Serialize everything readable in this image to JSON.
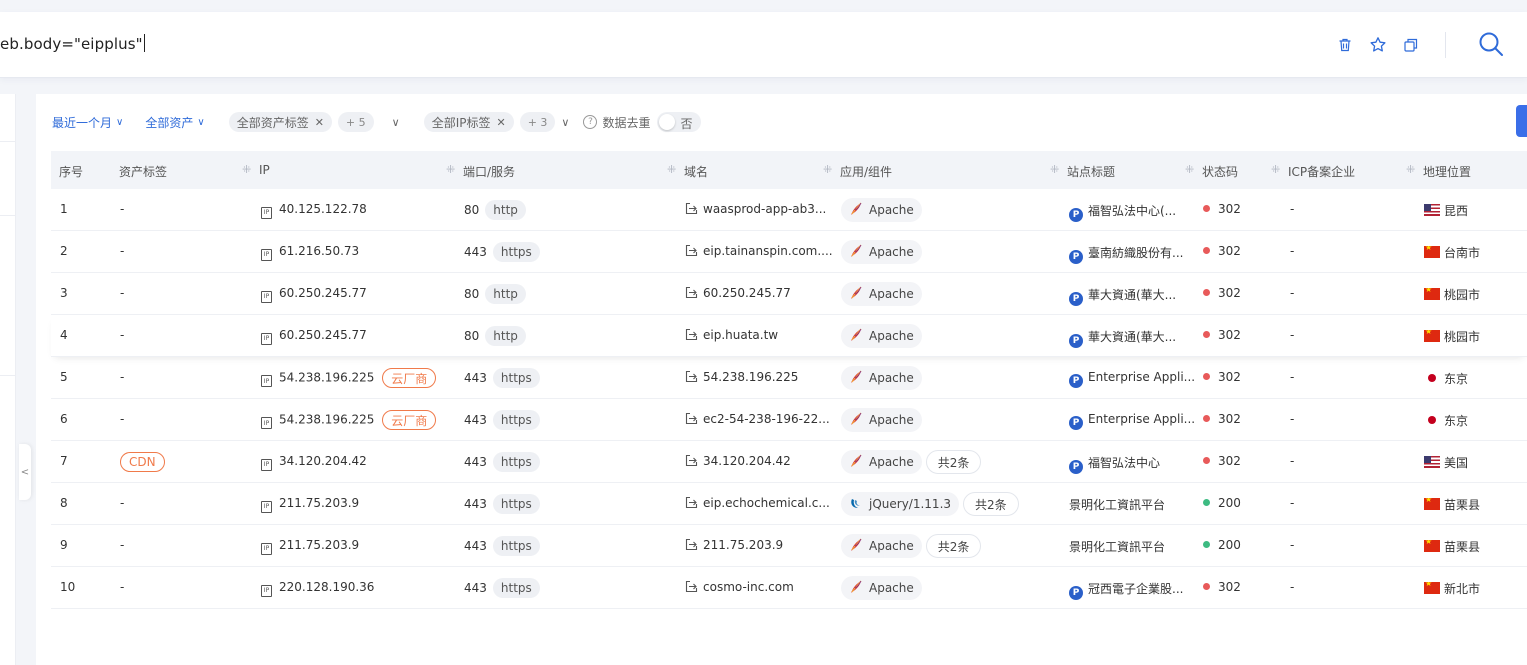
{
  "search": {
    "query": "eb.body=\"eipplus\"",
    "actions": [
      "delete-icon",
      "star-icon",
      "copy-icon",
      "search-icon"
    ]
  },
  "filters": {
    "time_range": "最近一个月",
    "asset_scope": "全部资产",
    "asset_tag": "全部资产标签",
    "asset_tag_more": "+ 5",
    "ip_tag": "全部IP标签",
    "ip_tag_more": "+ 3",
    "dedupe_label": "数据去重",
    "dedupe_value": "否"
  },
  "columns": {
    "index": "序号",
    "asset_tag": "资产标签",
    "ip": "IP",
    "port_service": "端口/服务",
    "domain": "域名",
    "app": "应用/组件",
    "site_title": "站点标题",
    "status": "状态码",
    "icp": "ICP备案企业",
    "geo": "地理位置"
  },
  "colors": {
    "accent": "#2f6bd9",
    "status_302": "#e85a5a",
    "status_200": "#3dbb82",
    "cloud_tag": "#f07a4a"
  },
  "rows": [
    {
      "idx": "1",
      "tag": "-",
      "ip": "40.125.122.78",
      "ip_badge": "",
      "port": "80",
      "service": "http",
      "domain": "waasprod-app-ab3...",
      "app": "Apache",
      "app_icon": "apache-feather-icon",
      "app_more": "",
      "title": "福智弘法中心(...",
      "title_icon": true,
      "status": "302",
      "status_ok": false,
      "icp": "-",
      "geo": "昆西",
      "flag": "us"
    },
    {
      "idx": "2",
      "tag": "-",
      "ip": "61.216.50.73",
      "ip_badge": "",
      "port": "443",
      "service": "https",
      "domain": "eip.tainanspin.com....",
      "app": "Apache",
      "app_icon": "apache-feather-icon",
      "app_more": "",
      "title": "臺南紡織股份有...",
      "title_icon": true,
      "status": "302",
      "status_ok": false,
      "icp": "-",
      "geo": "台南市",
      "flag": "cn"
    },
    {
      "idx": "3",
      "tag": "-",
      "ip": "60.250.245.77",
      "ip_badge": "",
      "port": "80",
      "service": "http",
      "domain": "60.250.245.77",
      "app": "Apache",
      "app_icon": "apache-feather-icon",
      "app_more": "",
      "title": "華大資通(華大...",
      "title_icon": true,
      "status": "302",
      "status_ok": false,
      "icp": "-",
      "geo": "桃园市",
      "flag": "cn"
    },
    {
      "idx": "4",
      "tag": "-",
      "ip": "60.250.245.77",
      "ip_badge": "",
      "port": "80",
      "service": "http",
      "domain": "eip.huata.tw",
      "app": "Apache",
      "app_icon": "apache-feather-icon",
      "app_more": "",
      "title": "華大資通(華大...",
      "title_icon": true,
      "status": "302",
      "status_ok": false,
      "icp": "-",
      "geo": "桃园市",
      "flag": "cn"
    },
    {
      "idx": "5",
      "tag": "-",
      "ip": "54.238.196.225",
      "ip_badge": "云厂商",
      "port": "443",
      "service": "https",
      "domain": "54.238.196.225",
      "app": "Apache",
      "app_icon": "apache-feather-icon",
      "app_more": "",
      "title": "Enterprise Appli...",
      "title_icon": true,
      "status": "302",
      "status_ok": false,
      "icp": "-",
      "geo": "东京",
      "flag": "jp"
    },
    {
      "idx": "6",
      "tag": "-",
      "ip": "54.238.196.225",
      "ip_badge": "云厂商",
      "port": "443",
      "service": "https",
      "domain": "ec2-54-238-196-22...",
      "app": "Apache",
      "app_icon": "apache-feather-icon",
      "app_more": "",
      "title": "Enterprise Appli...",
      "title_icon": true,
      "status": "302",
      "status_ok": false,
      "icp": "-",
      "geo": "东京",
      "flag": "jp"
    },
    {
      "idx": "7",
      "tag": "CDN",
      "ip": "34.120.204.42",
      "ip_badge": "",
      "port": "443",
      "service": "https",
      "domain": "34.120.204.42",
      "app": "Apache",
      "app_icon": "apache-feather-icon",
      "app_more": "共2条",
      "title": "福智弘法中心",
      "title_icon": true,
      "status": "302",
      "status_ok": false,
      "icp": "-",
      "geo": "美国",
      "flag": "us"
    },
    {
      "idx": "8",
      "tag": "-",
      "ip": "211.75.203.9",
      "ip_badge": "",
      "port": "443",
      "service": "https",
      "domain": "eip.echochemical.c...",
      "app": "jQuery/1.11.3",
      "app_icon": "jquery-icon",
      "app_more": "共2条",
      "title": "景明化工資訊平台",
      "title_icon": false,
      "status": "200",
      "status_ok": true,
      "icp": "-",
      "geo": "苗栗县",
      "flag": "cn"
    },
    {
      "idx": "9",
      "tag": "-",
      "ip": "211.75.203.9",
      "ip_badge": "",
      "port": "443",
      "service": "https",
      "domain": "211.75.203.9",
      "app": "Apache",
      "app_icon": "apache-feather-icon",
      "app_more": "共2条",
      "title": "景明化工資訊平台",
      "title_icon": false,
      "status": "200",
      "status_ok": true,
      "icp": "-",
      "geo": "苗栗县",
      "flag": "cn"
    },
    {
      "idx": "10",
      "tag": "-",
      "ip": "220.128.190.36",
      "ip_badge": "",
      "port": "443",
      "service": "https",
      "domain": "cosmo-inc.com",
      "app": "Apache",
      "app_icon": "apache-feather-icon",
      "app_more": "",
      "title": "冠西電子企業股...",
      "title_icon": true,
      "status": "302",
      "status_ok": false,
      "icp": "-",
      "geo": "新北市",
      "flag": "cn"
    }
  ]
}
